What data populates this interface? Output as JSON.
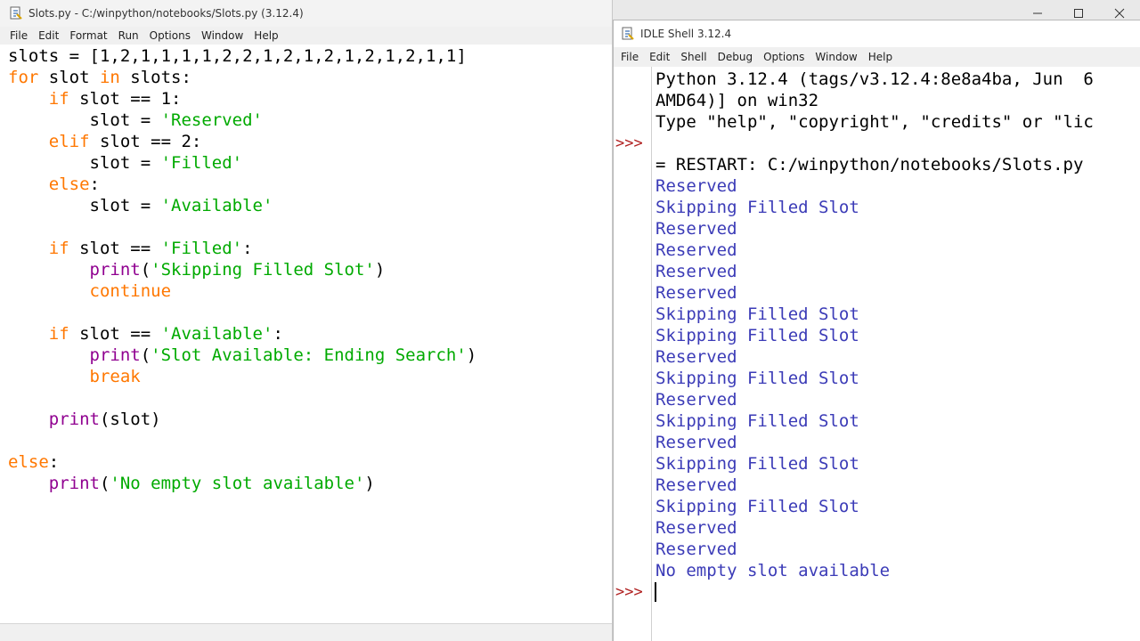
{
  "editor": {
    "title": "Slots.py - C:/winpython/notebooks/Slots.py (3.12.4)",
    "menu": [
      "File",
      "Edit",
      "Format",
      "Run",
      "Options",
      "Window",
      "Help"
    ],
    "code_lines": [
      [
        [
          "n",
          "slots = [1,2,1,1,1,1,2,2,1,2,1,2,1,2,1,2,1,1]"
        ]
      ],
      [
        [
          "k",
          "for"
        ],
        [
          "n",
          " slot "
        ],
        [
          "k",
          "in"
        ],
        [
          "n",
          " slots:"
        ]
      ],
      [
        [
          "n",
          "    "
        ],
        [
          "k",
          "if"
        ],
        [
          "n",
          " slot == 1:"
        ]
      ],
      [
        [
          "n",
          "        slot = "
        ],
        [
          "s",
          "'Reserved'"
        ]
      ],
      [
        [
          "n",
          "    "
        ],
        [
          "k",
          "elif"
        ],
        [
          "n",
          " slot == 2:"
        ]
      ],
      [
        [
          "n",
          "        slot = "
        ],
        [
          "s",
          "'Filled'"
        ]
      ],
      [
        [
          "n",
          "    "
        ],
        [
          "k",
          "else"
        ],
        [
          "n",
          ":"
        ]
      ],
      [
        [
          "n",
          "        slot = "
        ],
        [
          "s",
          "'Available'"
        ]
      ],
      [],
      [
        [
          "n",
          "    "
        ],
        [
          "k",
          "if"
        ],
        [
          "n",
          " slot == "
        ],
        [
          "s",
          "'Filled'"
        ],
        [
          "n",
          ":"
        ]
      ],
      [
        [
          "n",
          "        "
        ],
        [
          "b",
          "print"
        ],
        [
          "n",
          "("
        ],
        [
          "s",
          "'Skipping Filled Slot'"
        ],
        [
          "n",
          ")"
        ]
      ],
      [
        [
          "n",
          "        "
        ],
        [
          "k",
          "continue"
        ]
      ],
      [],
      [
        [
          "n",
          "    "
        ],
        [
          "k",
          "if"
        ],
        [
          "n",
          " slot == "
        ],
        [
          "s",
          "'Available'"
        ],
        [
          "n",
          ":"
        ]
      ],
      [
        [
          "n",
          "        "
        ],
        [
          "b",
          "print"
        ],
        [
          "n",
          "("
        ],
        [
          "s",
          "'Slot Available: Ending Search'"
        ],
        [
          "n",
          ")"
        ]
      ],
      [
        [
          "n",
          "        "
        ],
        [
          "k",
          "break"
        ]
      ],
      [],
      [
        [
          "n",
          "    "
        ],
        [
          "b",
          "print"
        ],
        [
          "n",
          "(slot)"
        ]
      ],
      [],
      [
        [
          "k",
          "else"
        ],
        [
          "n",
          ":"
        ]
      ],
      [
        [
          "n",
          "    "
        ],
        [
          "b",
          "print"
        ],
        [
          "n",
          "("
        ],
        [
          "s",
          "'No empty slot available'"
        ],
        [
          "n",
          ")"
        ]
      ]
    ]
  },
  "shell": {
    "title": "IDLE Shell 3.12.4",
    "menu": [
      "File",
      "Edit",
      "Shell",
      "Debug",
      "Options",
      "Window",
      "Help"
    ],
    "prompt": ">>>",
    "lines": [
      {
        "text": "Python 3.12.4 (tags/v3.12.4:8e8a4ba, Jun  6",
        "kind": "info"
      },
      {
        "text": "AMD64)] on win32",
        "kind": "info"
      },
      {
        "text": "Type \"help\", \"copyright\", \"credits\" or \"lic",
        "kind": "info"
      },
      {
        "text": "",
        "kind": "prompt"
      },
      {
        "text": "= RESTART: C:/winpython/notebooks/Slots.py",
        "kind": "info"
      },
      {
        "text": "Reserved",
        "kind": "out"
      },
      {
        "text": "Skipping Filled Slot",
        "kind": "out"
      },
      {
        "text": "Reserved",
        "kind": "out"
      },
      {
        "text": "Reserved",
        "kind": "out"
      },
      {
        "text": "Reserved",
        "kind": "out"
      },
      {
        "text": "Reserved",
        "kind": "out"
      },
      {
        "text": "Skipping Filled Slot",
        "kind": "out"
      },
      {
        "text": "Skipping Filled Slot",
        "kind": "out"
      },
      {
        "text": "Reserved",
        "kind": "out"
      },
      {
        "text": "Skipping Filled Slot",
        "kind": "out"
      },
      {
        "text": "Reserved",
        "kind": "out"
      },
      {
        "text": "Skipping Filled Slot",
        "kind": "out"
      },
      {
        "text": "Reserved",
        "kind": "out"
      },
      {
        "text": "Skipping Filled Slot",
        "kind": "out"
      },
      {
        "text": "Reserved",
        "kind": "out"
      },
      {
        "text": "Skipping Filled Slot",
        "kind": "out"
      },
      {
        "text": "Reserved",
        "kind": "out"
      },
      {
        "text": "Reserved",
        "kind": "out"
      },
      {
        "text": "No empty slot available",
        "kind": "out"
      },
      {
        "text": "",
        "kind": "prompt-cursor"
      }
    ]
  },
  "window_controls": [
    "minimize-icon",
    "maximize-icon",
    "close-icon"
  ],
  "colors": {
    "keyword": "#ff7700",
    "string": "#00aa00",
    "builtin": "#900090",
    "shell_output": "#3b3bb7",
    "prompt": "#b02020"
  }
}
